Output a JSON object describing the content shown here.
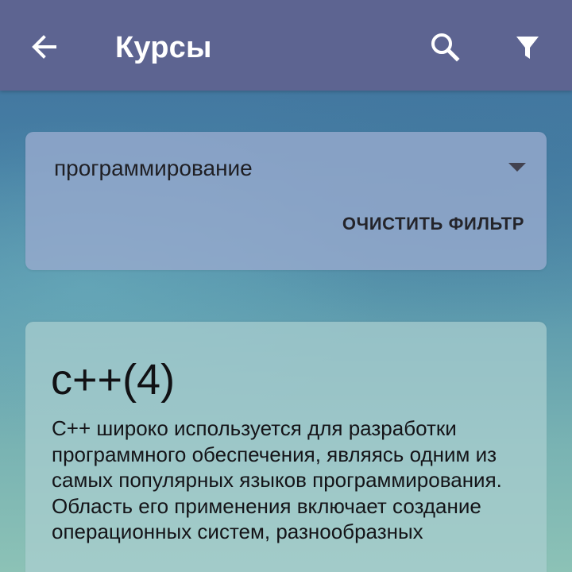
{
  "appbar": {
    "title": "Курсы",
    "background": "#5d6491",
    "back_icon": "arrow-left-icon",
    "search_icon": "search-icon",
    "filter_icon": "filter-icon"
  },
  "filter": {
    "selected_category": "программирование",
    "clear_label": "ОЧИСТИТЬ ФИЛЬТР",
    "caret_icon": "caret-down-icon"
  },
  "courses": [
    {
      "title": "c++(4)",
      "description": "C++ широко используется для разработки программного обеспечения, являясь одним из самых популярных языков программирования. Область его применения включает создание операционных систем, разнообразных"
    }
  ]
}
